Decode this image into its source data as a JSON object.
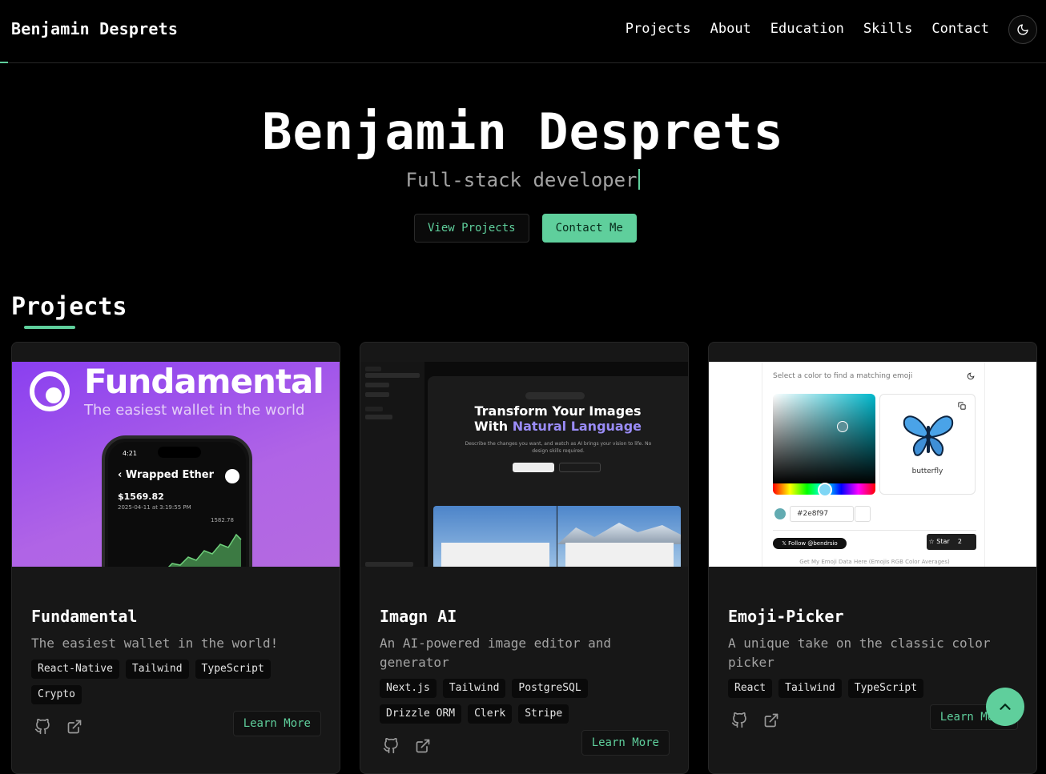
{
  "header": {
    "brand": "Benjamin Desprets",
    "nav": [
      "Projects",
      "About",
      "Education",
      "Skills",
      "Contact"
    ]
  },
  "hero": {
    "title": "Benjamin Desprets",
    "subtitle": "Full-stack developer",
    "buttons": {
      "view_projects": "View Projects",
      "contact_me": "Contact Me"
    }
  },
  "projects": {
    "heading": "Projects",
    "learn_more": "Learn More",
    "cards": [
      {
        "title": "Fundamental",
        "description": "The easiest wallet in the world!",
        "tags": [
          "React-Native",
          "Tailwind",
          "TypeScript",
          "Crypto"
        ],
        "image": {
          "brand": "Fundamental",
          "tagline": "The easiest wallet in the world",
          "time": "4:21",
          "asset": "Wrapped Ether",
          "price": "$1569.82",
          "date": "2025-04-11 at 3:19:55 PM",
          "high": "1582.78"
        }
      },
      {
        "title": "Imagn AI",
        "description": "An AI-powered image editor and generator",
        "tags": [
          "Next.js",
          "Tailwind",
          "PostgreSQL",
          "Drizzle ORM",
          "Clerk",
          "Stripe"
        ],
        "image": {
          "headline_1": "Transform Your Images",
          "headline_2_a": "With ",
          "headline_2_b": "Natural Language",
          "body": "Describe the changes you want, and watch as AI brings your vision to life. No design skills required."
        }
      },
      {
        "title": "Emoji-Picker",
        "description": "A unique take on the classic color picker",
        "tags": [
          "React",
          "Tailwind",
          "TypeScript"
        ],
        "image": {
          "prompt": "Select a color to find a matching emoji",
          "emoji_name": "butterfly",
          "hex": "#2e8f97",
          "follow": "𝕏 Follow @bendrsio",
          "star": "Star",
          "star_count": "2",
          "footer": "Get My Emoji Data Here (Emojis RGB Color Averages)"
        }
      }
    ]
  },
  "colors": {
    "accent": "#5fcf9c",
    "background": "#000000",
    "card": "#171717"
  }
}
